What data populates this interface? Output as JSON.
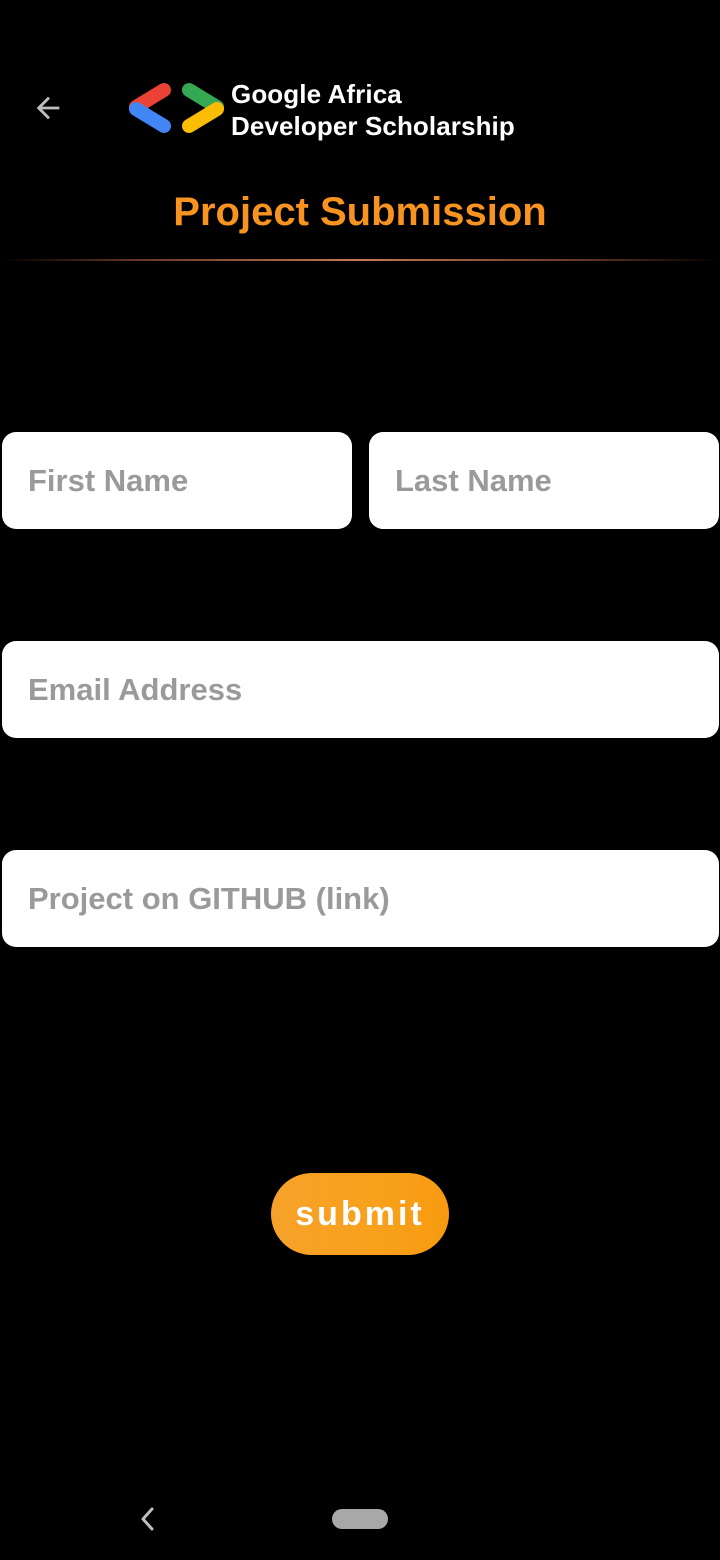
{
  "header": {
    "back_icon": "arrow-left-icon",
    "logo_icon": "google-developers-logo-icon",
    "brand_line1": "Google Africa",
    "brand_line2": "Developer Scholarship",
    "title": "Project Submission"
  },
  "form": {
    "first_name": {
      "placeholder": "First Name",
      "value": ""
    },
    "last_name": {
      "placeholder": "Last Name",
      "value": ""
    },
    "email": {
      "placeholder": "Email Address",
      "value": ""
    },
    "github": {
      "placeholder": "Project on GITHUB (link)",
      "value": ""
    },
    "submit_label": "submit"
  },
  "system_nav": {
    "back_icon": "chevron-left-icon",
    "home_icon": "home-pill-icon"
  },
  "colors": {
    "background": "#000000",
    "accent": "#f7931e",
    "field_background": "#ffffff",
    "placeholder": "#9a9a9a",
    "logo_red": "#ea4335",
    "logo_blue": "#4285f4",
    "logo_green": "#34a853",
    "logo_yellow": "#fbbc04"
  }
}
